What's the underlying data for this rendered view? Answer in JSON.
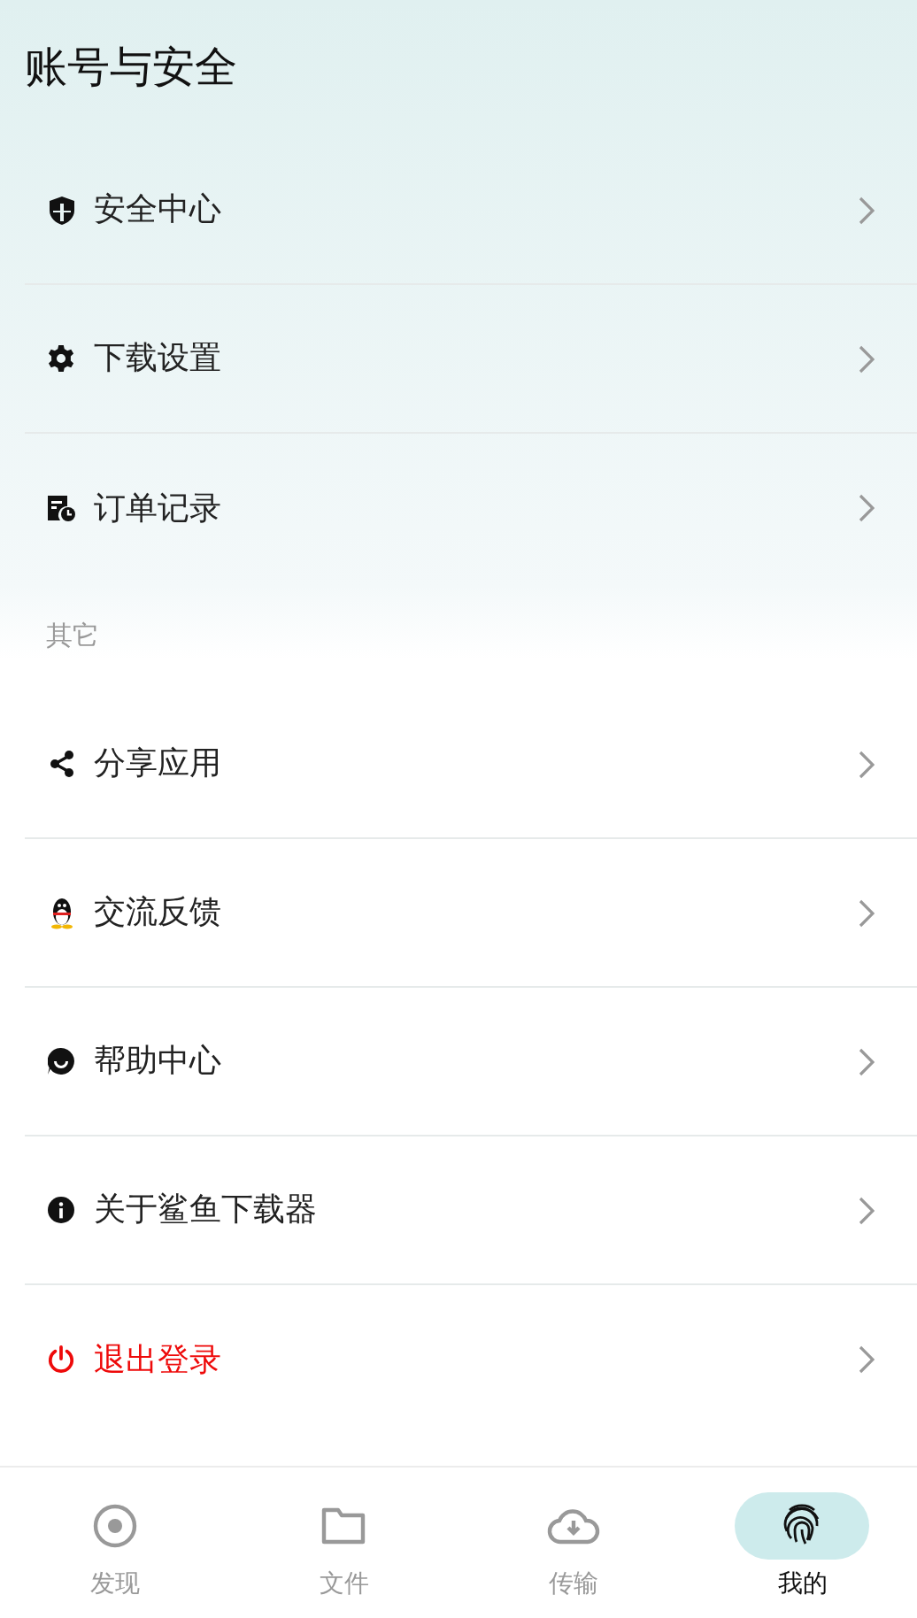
{
  "page_title": "账号与安全",
  "sections": [
    {
      "items": [
        {
          "label": "安全中心",
          "danger": false
        },
        {
          "label": "下载设置",
          "danger": false
        },
        {
          "label": "订单记录",
          "danger": false
        }
      ]
    },
    {
      "title": "其它",
      "items": [
        {
          "label": "分享应用",
          "danger": false
        },
        {
          "label": "交流反馈",
          "danger": false
        },
        {
          "label": "帮助中心",
          "danger": false
        },
        {
          "label": "关于鲨鱼下载器",
          "danger": false
        },
        {
          "label": "退出登录",
          "danger": true
        }
      ]
    }
  ],
  "bottom_nav": [
    {
      "label": "发现",
      "selected": false
    },
    {
      "label": "文件",
      "selected": false
    },
    {
      "label": "传输",
      "selected": false
    },
    {
      "label": "我的",
      "selected": true
    }
  ]
}
